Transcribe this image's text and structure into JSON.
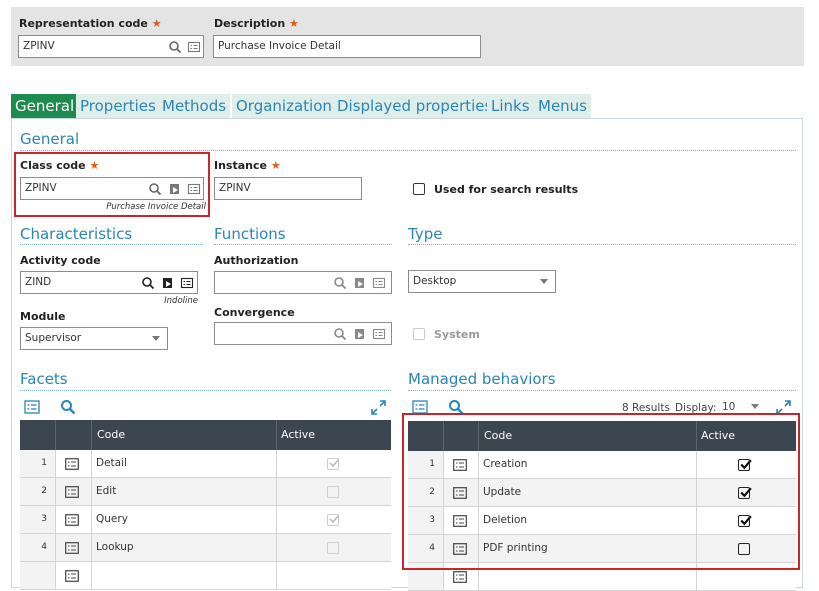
{
  "header": {
    "representation_code_label": "Representation code",
    "representation_code_value": "ZPINV",
    "description_label": "Description",
    "description_value": "Purchase Invoice Detail",
    "required_mark": "★"
  },
  "tabs": [
    {
      "label": "General",
      "active": true
    },
    {
      "label": "Properties"
    },
    {
      "label": "Methods"
    },
    {
      "label": "Organization"
    },
    {
      "label": "Displayed properties"
    },
    {
      "label": "Links"
    },
    {
      "label": "Menus"
    }
  ],
  "general": {
    "title": "General",
    "class_code_label": "Class code",
    "class_code_value": "ZPINV",
    "class_code_desc": "Purchase Invoice Detail",
    "instance_label": "Instance",
    "instance_value": "ZPINV",
    "search_results_label": "Used for search results"
  },
  "characteristics": {
    "title": "Characteristics",
    "activity_code_label": "Activity code",
    "activity_code_value": "ZIND",
    "activity_code_desc": "Indoline",
    "module_label": "Module",
    "module_value": "Supervisor"
  },
  "functions": {
    "title": "Functions",
    "authorization_label": "Authorization",
    "convergence_label": "Convergence"
  },
  "type": {
    "title": "Type",
    "type_value": "Desktop",
    "system_label": "System"
  },
  "facets": {
    "title": "Facets",
    "col_code": "Code",
    "col_active": "Active",
    "rows": [
      {
        "num": "1",
        "code": "Detail",
        "active": true
      },
      {
        "num": "2",
        "code": "Edit",
        "active": false
      },
      {
        "num": "3",
        "code": "Query",
        "active": true
      },
      {
        "num": "4",
        "code": "Lookup",
        "active": false
      }
    ]
  },
  "managed": {
    "title": "Managed behaviors",
    "results_text": "8 Results",
    "display_label": "Display:",
    "display_value": "10",
    "col_code": "Code",
    "col_active": "Active",
    "rows": [
      {
        "num": "1",
        "code": "Creation",
        "active": true
      },
      {
        "num": "2",
        "code": "Update",
        "active": true
      },
      {
        "num": "3",
        "code": "Deletion",
        "active": true
      },
      {
        "num": "4",
        "code": "PDF printing",
        "active": false
      }
    ]
  },
  "colors": {
    "accent_blue": "#2a85b9",
    "active_tab": "#1f8a4f",
    "required_star": "#e05a1c",
    "header_dark": "#3c4650",
    "highlight_red": "#c9252c"
  }
}
